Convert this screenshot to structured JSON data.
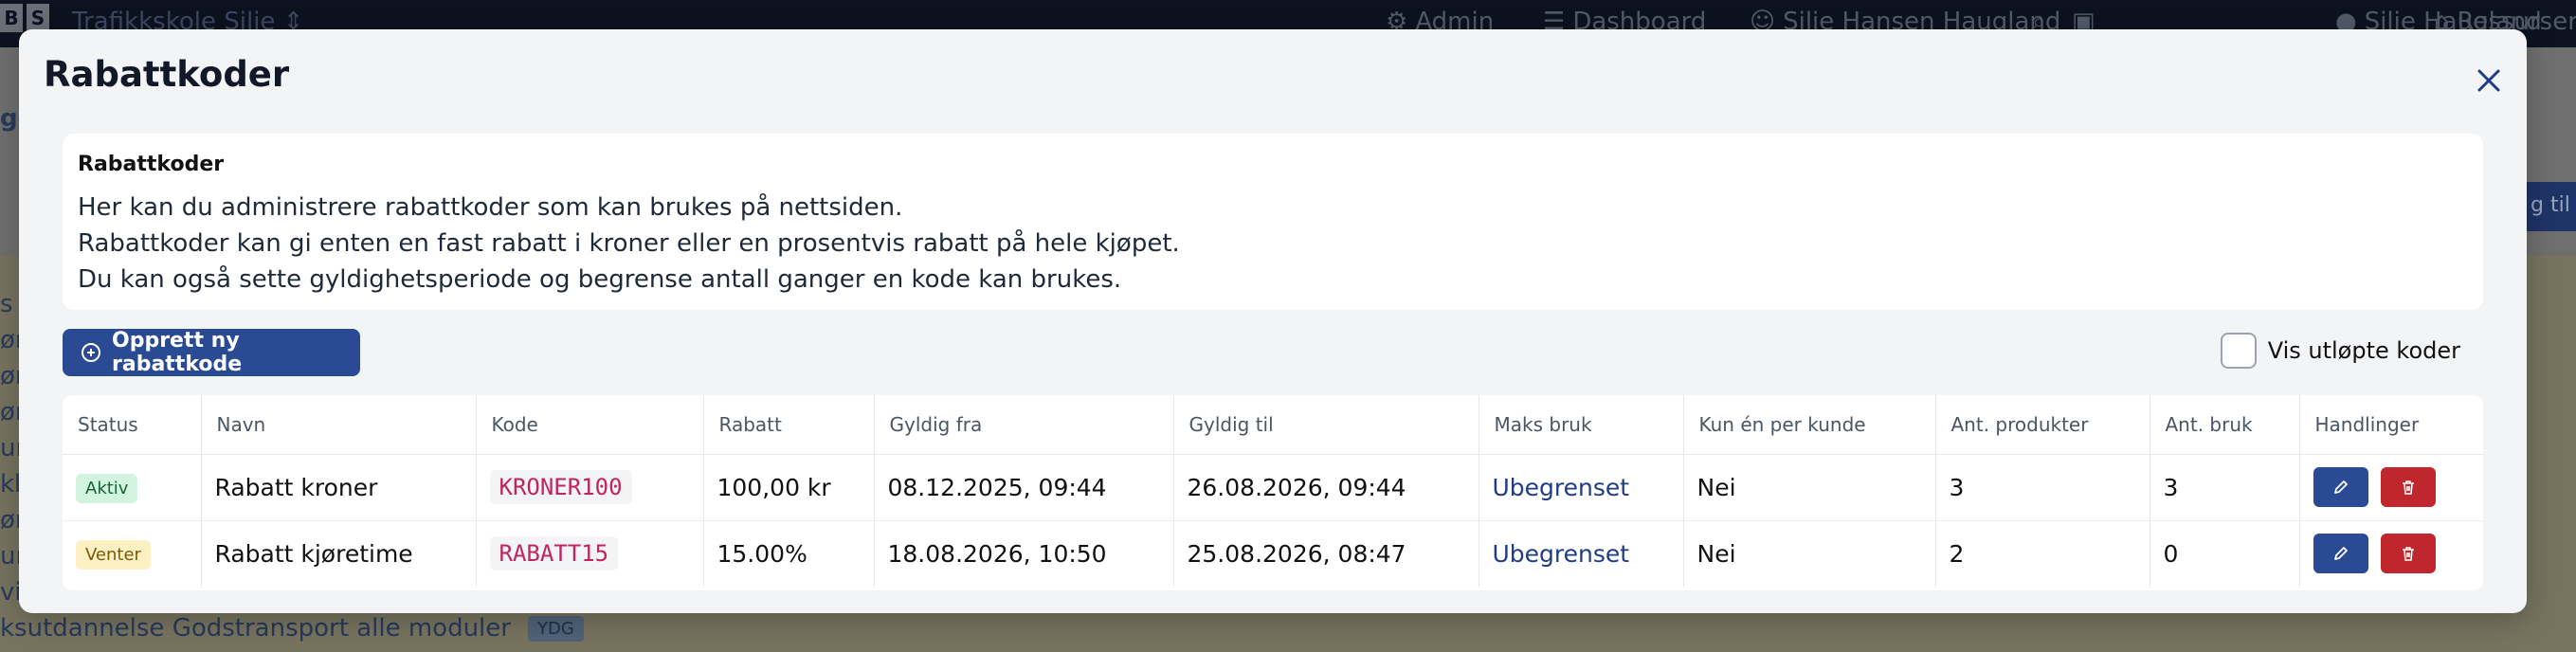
{
  "background": {
    "logo_letters": [
      "B",
      "S"
    ],
    "brand": "Trafikkskole Silje",
    "nav": {
      "admin": "Admin",
      "dashboard": "Dashboard",
      "user": "Silje Hansen Haugland",
      "resources": "Ressurser",
      "profile": "Silje Haugland"
    },
    "left_fragments": [
      "ge",
      "s",
      "ør",
      "ør",
      "ør",
      "ur",
      "kk",
      "ør",
      "ur",
      "vi",
      "vi"
    ],
    "right_button": "g til p",
    "bottom_text": "ksutdannelse Godstransport alle moduler",
    "bottom_tag": "YDG"
  },
  "modal": {
    "title": "Rabattkoder",
    "info": {
      "heading": "Rabattkoder",
      "lines": [
        "Her kan du administrere rabattkoder som kan brukes på nettsiden.",
        "Rabattkoder kan gi enten en fast rabatt i kroner eller en prosentvis rabatt på hele kjøpet.",
        "Du kan også sette gyldighetsperiode og begrense antall ganger en kode kan brukes."
      ]
    },
    "create_button": "Opprett ny rabattkode",
    "show_expired_label": "Vis utløpte koder",
    "table": {
      "headers": [
        "Status",
        "Navn",
        "Kode",
        "Rabatt",
        "Gyldig fra",
        "Gyldig til",
        "Maks bruk",
        "Kun én per kunde",
        "Ant. produkter",
        "Ant. bruk",
        "Handlinger"
      ],
      "rows": [
        {
          "status": "Aktiv",
          "name": "Rabatt kroner",
          "code": "KRONER100",
          "discount": "100,00 kr",
          "valid_from": "08.12.2025, 09:44",
          "valid_to": "26.08.2026, 09:44",
          "max_use": "Ubegrenset",
          "one_per_customer": "Nei",
          "products": "3",
          "uses": "3"
        },
        {
          "status": "Venter",
          "name": "Rabatt kjøretime",
          "code": "RABATT15",
          "discount": "15.00%",
          "valid_from": "18.08.2026, 10:50",
          "valid_to": "25.08.2026, 08:47",
          "max_use": "Ubegrenset",
          "one_per_customer": "Nei",
          "products": "2",
          "uses": "0"
        }
      ]
    }
  },
  "colors": {
    "primary": "#2b4a94",
    "danger": "#c0262d",
    "active_badge_bg": "#d1f3df",
    "pending_badge_bg": "#fdf0c2",
    "code_text": "#c0265d"
  },
  "icons": {
    "close": "close-icon",
    "create": "plus-circle-icon",
    "edit": "pencil-icon",
    "delete": "trash-icon"
  }
}
